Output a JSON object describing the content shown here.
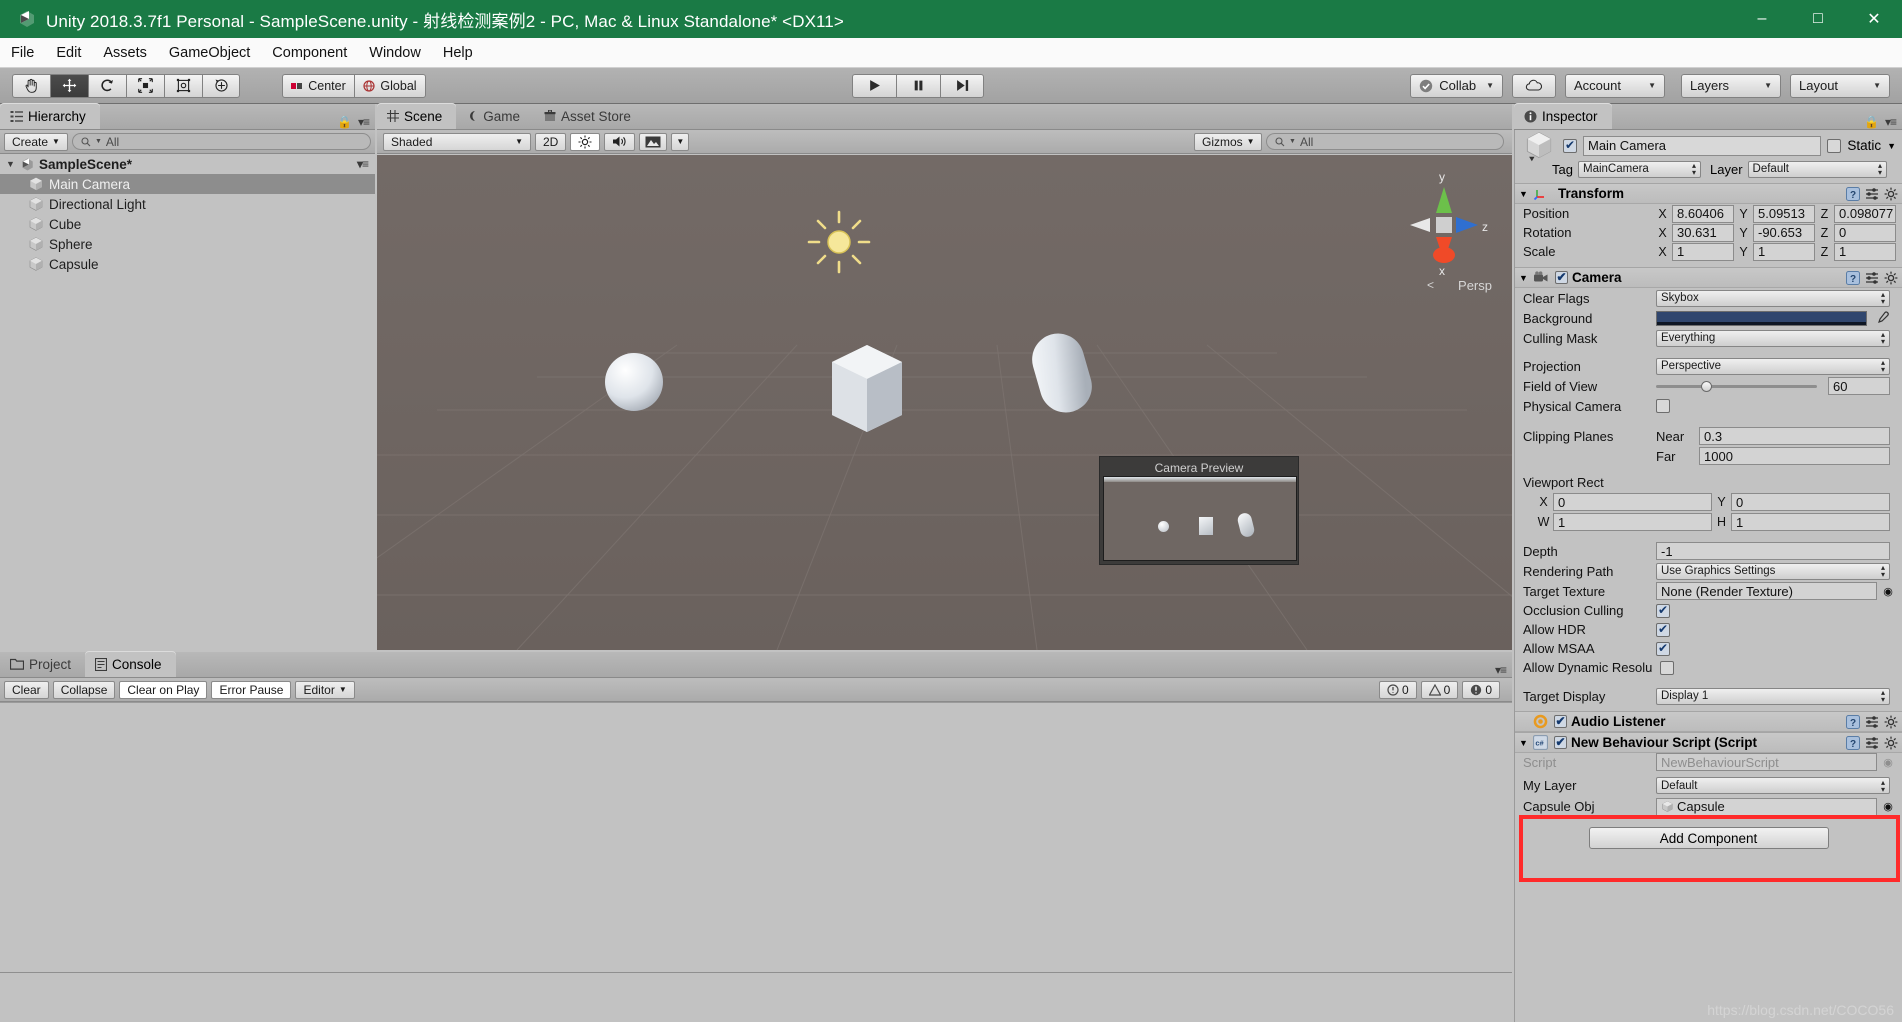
{
  "window": {
    "title": "Unity 2018.3.7f1 Personal - SampleScene.unity - 射线检测案例2 - PC, Mac & Linux Standalone* <DX11>",
    "minimize": "–",
    "maximize": "□",
    "close": "✕",
    "titlebar_color": "#1a7a45"
  },
  "menu": {
    "items": [
      "File",
      "Edit",
      "Assets",
      "GameObject",
      "Component",
      "Window",
      "Help"
    ]
  },
  "toolbar": {
    "tools": [
      "hand-tool",
      "move-tool",
      "rotate-tool",
      "scale-tool",
      "rect-tool",
      "transform-tool"
    ],
    "active_tool_index": 1,
    "pivot_mode": "Center",
    "pivot_rotation": "Global",
    "play": "▶",
    "pause": "❙❙",
    "step": "▶❙",
    "collab": "Collab",
    "cloud": "cloud-icon",
    "account": "Account",
    "layers": "Layers",
    "layout": "Layout"
  },
  "hierarchy": {
    "tab": "Hierarchy",
    "create_button": "Create",
    "search_placeholder": "All",
    "scene_root": "SampleScene*",
    "items": [
      {
        "label": "Main Camera",
        "selected": true
      },
      {
        "label": "Directional Light",
        "selected": false
      },
      {
        "label": "Cube",
        "selected": false
      },
      {
        "label": "Sphere",
        "selected": false
      },
      {
        "label": "Capsule",
        "selected": false
      }
    ]
  },
  "scene": {
    "tabs": [
      {
        "label": "Scene",
        "icon": "grid-icon",
        "active": true
      },
      {
        "label": "Game",
        "icon": "gamepad-icon",
        "active": false
      },
      {
        "label": "Asset Store",
        "icon": "store-icon",
        "active": false
      }
    ],
    "draw_mode": "Shaded",
    "twod_button": "2D",
    "lighting_icon": "sun-icon",
    "audio_icon": "speaker-icon",
    "effects_icon": "image-icon",
    "gizmos_button": "Gizmos",
    "search_placeholder": "All",
    "axis_labels": {
      "x": "x",
      "y": "y",
      "z": "z"
    },
    "persp_label": "Persp",
    "camera_preview_title": "Camera Preview"
  },
  "inspector": {
    "tab": "Inspector",
    "object_name": "Main Camera",
    "object_enabled": true,
    "static_label": "Static",
    "static_checked": false,
    "tag_label": "Tag",
    "tag_value": "MainCamera",
    "layer_label": "Layer",
    "layer_value": "Default",
    "components": [
      {
        "name": "Transform",
        "icon": "transform-icon",
        "rows": [
          {
            "label": "Position",
            "x": "8.60406",
            "y": "5.09513",
            "z": "0.098077"
          },
          {
            "label": "Rotation",
            "x": "30.631",
            "y": "-90.653",
            "z": "0"
          },
          {
            "label": "Scale",
            "x": "1",
            "y": "1",
            "z": "1"
          }
        ]
      }
    ],
    "camera": {
      "name": "Camera",
      "enabled": true,
      "clear_flags_label": "Clear Flags",
      "clear_flags_value": "Skybox",
      "background_label": "Background",
      "background_color": "#30466e",
      "culling_mask_label": "Culling Mask",
      "culling_mask_value": "Everything",
      "projection_label": "Projection",
      "projection_value": "Perspective",
      "fov_label": "Field of View",
      "fov_value": "60",
      "physical_camera_label": "Physical Camera",
      "physical_camera_checked": false,
      "clipping_label": "Clipping Planes",
      "near_label": "Near",
      "near_value": "0.3",
      "far_label": "Far",
      "far_value": "1000",
      "viewport_label": "Viewport Rect",
      "viewport_x_label": "X",
      "viewport_x": "0",
      "viewport_y_label": "Y",
      "viewport_y": "0",
      "viewport_w_label": "W",
      "viewport_w": "1",
      "viewport_h_label": "H",
      "viewport_h": "1",
      "depth_label": "Depth",
      "depth_value": "-1",
      "rendering_path_label": "Rendering Path",
      "rendering_path_value": "Use Graphics Settings",
      "target_texture_label": "Target Texture",
      "target_texture_value": "None (Render Texture)",
      "occlusion_label": "Occlusion Culling",
      "occlusion_checked": true,
      "hdr_label": "Allow HDR",
      "hdr_checked": true,
      "msaa_label": "Allow MSAA",
      "msaa_checked": true,
      "dynres_label": "Allow Dynamic Resolu",
      "dynres_checked": false,
      "target_display_label": "Target Display",
      "target_display_value": "Display 1"
    },
    "audio_listener": {
      "name": "Audio Listener",
      "enabled": true
    },
    "script_component": {
      "name": "New Behaviour Script (Script",
      "enabled": true,
      "script_label": "Script",
      "script_value": "NewBehaviourScript",
      "my_layer_label": "My Layer",
      "my_layer_value": "Default",
      "capsule_obj_label": "Capsule Obj",
      "capsule_obj_value": "Capsule",
      "highlight_color": "#ff2a2a"
    },
    "add_component": "Add Component"
  },
  "console": {
    "tabs": [
      {
        "label": "Project",
        "icon": "folder-icon",
        "active": false
      },
      {
        "label": "Console",
        "icon": "console-icon",
        "active": true
      }
    ],
    "buttons": [
      "Clear",
      "Collapse",
      "Clear on Play",
      "Error Pause"
    ],
    "editor_dropdown": "Editor",
    "counts": {
      "info": "0",
      "warning": "0",
      "error": "0"
    }
  },
  "watermark": "https://blog.csdn.net/COCO56"
}
